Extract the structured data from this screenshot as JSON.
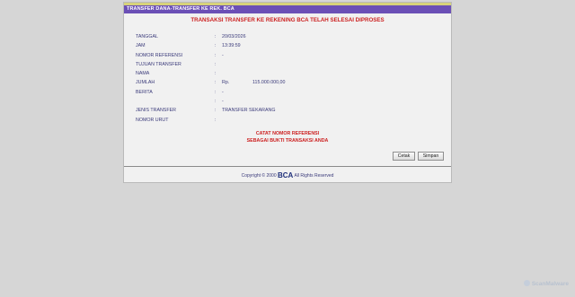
{
  "header": {
    "title": "TRANSFER DANA-TRANSFER KE REK. BCA",
    "headline": "TRANSAKSI TRANSFER KE REKENING BCA TELAH SELESAI DIPROSES"
  },
  "details": {
    "tanggal": {
      "label": "TANGGAL",
      "value": "20/03/2026"
    },
    "jam": {
      "label": "JAM",
      "value": "13:39:59"
    },
    "nomor_referensi": {
      "label": "NOMOR REFERENSI",
      "value": "-"
    },
    "tujuan_transfer": {
      "label": "TUJUAN TRANSFER",
      "value": ""
    },
    "nama": {
      "label": "NAMA",
      "value": ""
    },
    "jumlah": {
      "label": "JUMLAH",
      "currency": "Rp.",
      "value": "115.000.000,00"
    },
    "berita": {
      "label": "BERITA",
      "value": "-",
      "value2": "-"
    },
    "jenis_transfer": {
      "label": "JENIS TRANSFER",
      "value": "TRANSFER SEKARANG"
    },
    "nomor_urut": {
      "label": "NOMOR URUT",
      "value": ""
    }
  },
  "colon": ":",
  "note": {
    "line1": "CATAT NOMOR REFERENSI",
    "line2": "SEBAGAI BUKTI TRANSAKSI ANDA"
  },
  "buttons": {
    "print_label": "Cetak",
    "save_label": "Simpan"
  },
  "footer": {
    "copyright_prefix": "Copyright © 2000",
    "brand": "BCA",
    "rights": "All Rights Reserved"
  },
  "watermark": {
    "text": "ScanMalware",
    "icon": "scanmalware-logo-icon"
  },
  "colors": {
    "title_bar": "#6b4fb6",
    "accent_red": "#cc1f1f",
    "label_blue": "#3a3a7a"
  }
}
